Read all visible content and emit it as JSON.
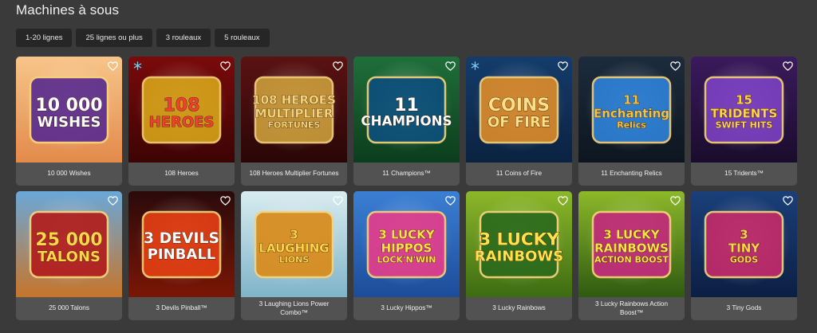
{
  "page": {
    "title": "Machines à sous"
  },
  "filters": [
    {
      "label": "1-20 lignes"
    },
    {
      "label": "25 lignes ou plus"
    },
    {
      "label": "3 rouleaux"
    },
    {
      "label": "5 rouleaux"
    }
  ],
  "games": [
    {
      "name": "10 000 Wishes",
      "logo": [
        "10 000",
        "WISHES"
      ],
      "bg": [
        "#f7c58a",
        "#e38a4b"
      ],
      "accent": "#5b2d8f",
      "text": "#ffffff",
      "snow": false
    },
    {
      "name": "108 Heroes",
      "logo": [
        "108",
        "HEROES"
      ],
      "bg": [
        "#7a0a0a",
        "#3d0404"
      ],
      "accent": "#d4a017",
      "text": "#f04030",
      "snow": true
    },
    {
      "name": "108 Heroes Multiplier Fortunes",
      "logo": [
        "108 HEROES",
        "MULTIPLIER",
        "FORTUNES"
      ],
      "bg": [
        "#5a1212",
        "#2a0606"
      ],
      "accent": "#c89a3a",
      "text": "#f3d27a",
      "snow": false
    },
    {
      "name": "11 Champions™",
      "logo": [
        "11",
        "CHAMPIONS"
      ],
      "bg": [
        "#1f6f3a",
        "#0c3d1d"
      ],
      "accent": "#0d4f7a",
      "text": "#ffffff",
      "snow": false
    },
    {
      "name": "11 Coins of Fire",
      "logo": [
        "COINS",
        "OF FIRE"
      ],
      "bg": [
        "#143c6b",
        "#0b2240"
      ],
      "accent": "#d9892a",
      "text": "#ffe08a",
      "snow": true
    },
    {
      "name": "11 Enchanting Relics",
      "logo": [
        "11",
        "Enchanting",
        "Relics"
      ],
      "bg": [
        "#1c2b3c",
        "#0d1620"
      ],
      "accent": "#2d7fd6",
      "text": "#f5c542",
      "snow": false
    },
    {
      "name": "15 Tridents™",
      "logo": [
        "15",
        "TRIDENTS",
        "SWIFT HITS"
      ],
      "bg": [
        "#3a1a5c",
        "#1a0c2c"
      ],
      "accent": "#7a3fbf",
      "text": "#ffd34d",
      "snow": false
    },
    {
      "name": "25 000 Talons",
      "logo": [
        "25 000",
        "TALONS"
      ],
      "bg": [
        "#6aa8d8",
        "#c7752a"
      ],
      "accent": "#b11e1e",
      "text": "#ffd54a",
      "snow": false
    },
    {
      "name": "3 Devils Pinball™",
      "logo": [
        "3 DEVILS",
        "PINBALL"
      ],
      "bg": [
        "#2a0a0a",
        "#7a1606"
      ],
      "accent": "#e23d12",
      "text": "#ffffff",
      "snow": false
    },
    {
      "name": "3 Laughing Lions Power Combo™",
      "logo": [
        "3",
        "LAUGHING",
        "LIONS"
      ],
      "bg": [
        "#d8ecf0",
        "#7fb4c8"
      ],
      "accent": "#d98b1a",
      "text": "#ffd54a",
      "snow": false
    },
    {
      "name": "3 Lucky Hippos™",
      "logo": [
        "3 LUCKY",
        "HIPPOS",
        "LOCK'N'WIN"
      ],
      "bg": [
        "#3b7fd4",
        "#1c4c9a"
      ],
      "accent": "#e23d8c",
      "text": "#ffe14a",
      "snow": false
    },
    {
      "name": "3 Lucky Rainbows",
      "logo": [
        "3 LUCKY",
        "RAINBOWS"
      ],
      "bg": [
        "#8cb82a",
        "#3d6b12"
      ],
      "accent": "#2b6b1c",
      "text": "#ffe14a",
      "snow": false
    },
    {
      "name": "3 Lucky Rainbows Action Boost™",
      "logo": [
        "3 LUCKY",
        "RAINBOWS",
        "ACTION BOOST"
      ],
      "bg": [
        "#8cb82a",
        "#2f5a10"
      ],
      "accent": "#c22a7a",
      "text": "#ffe14a",
      "snow": false
    },
    {
      "name": "3 Tiny Gods",
      "logo": [
        "3",
        "TINY",
        "GODS"
      ],
      "bg": [
        "#1a3f7a",
        "#0c1f42"
      ],
      "accent": "#c22a6a",
      "text": "#ffd34d",
      "snow": false
    }
  ]
}
